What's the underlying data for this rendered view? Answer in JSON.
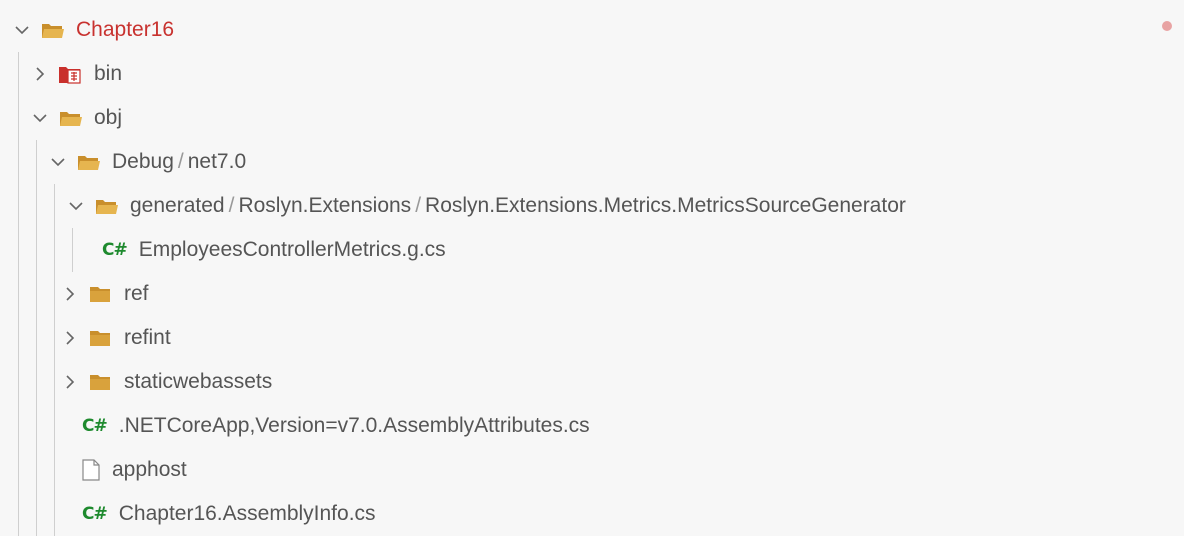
{
  "tree": {
    "root": {
      "label": "Chapter16",
      "expanded": true,
      "icon": "open-folder-icon",
      "color": "#c8322f",
      "modified_dot_color": "#e8a3a3"
    },
    "bin": {
      "label": "bin",
      "expanded": false,
      "icon": "excluded-folder-icon"
    },
    "obj": {
      "label": "obj",
      "expanded": true,
      "icon": "open-folder-icon"
    },
    "debug": {
      "segments": [
        "Debug",
        "net7.0"
      ],
      "expanded": true,
      "icon": "open-folder-icon"
    },
    "generated": {
      "segments": [
        "generated",
        "Roslyn.Extensions",
        "Roslyn.Extensions.Metrics.MetricsSourceGenerator"
      ],
      "expanded": true,
      "icon": "open-folder-icon"
    },
    "metrics_file": {
      "label": "EmployeesControllerMetrics.g.cs",
      "icon": "csharp-file-icon",
      "icon_text": "C#"
    },
    "ref": {
      "label": "ref",
      "expanded": false,
      "icon": "folder-icon"
    },
    "refint": {
      "label": "refint",
      "expanded": false,
      "icon": "folder-icon"
    },
    "staticwebassets": {
      "label": "staticwebassets",
      "expanded": false,
      "icon": "folder-icon"
    },
    "assembly_attributes": {
      "label": ".NETCoreApp,Version=v7.0.AssemblyAttributes.cs",
      "icon": "csharp-file-icon",
      "icon_text": "C#"
    },
    "apphost": {
      "label": "apphost",
      "icon": "file-icon"
    },
    "assembly_info": {
      "label": "Chapter16.AssemblyInfo.cs",
      "icon": "csharp-file-icon",
      "icon_text": "C#"
    }
  },
  "colors": {
    "background": "#f7f7f7",
    "csharp_icon": "#1e8a2e",
    "folder": "#d9a23c"
  }
}
